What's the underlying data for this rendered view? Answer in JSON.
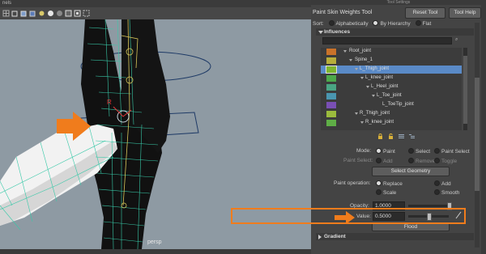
{
  "viewport": {
    "title_fragment": "nels",
    "camera_label": "persp",
    "joint_marker_label": "R",
    "toolbar_icons": [
      "grid-icon",
      "box-icon",
      "shaded-box-icon",
      "textured-icon",
      "light-icon",
      "sphere-icon",
      "isolate-icon",
      "xray-icon",
      "camera-icon",
      "frame-icon"
    ]
  },
  "panel": {
    "header": "Tool Settings",
    "tool_title": "Paint Skin Weights Tool",
    "reset_tool": "Reset Tool",
    "tool_help": "Tool Help",
    "sort": {
      "label": "Sort:",
      "options": [
        "Alphabetically",
        "By Hierarchy",
        "Flat"
      ],
      "selected": "By Hierarchy"
    },
    "influences": {
      "title": "Influences",
      "joints": [
        {
          "name": "Root_joint",
          "color": "#c9722a"
        },
        {
          "name": "Spine_1",
          "color": "#b7ad3a"
        },
        {
          "name": "L_Thigh_joint",
          "color": "#7fb62f",
          "selected": true
        },
        {
          "name": "L_knee_joint",
          "color": "#4da84a"
        },
        {
          "name": "L_Heel_joint",
          "color": "#4aa583"
        },
        {
          "name": "L_Toe_joint",
          "color": "#4a96b0"
        },
        {
          "name": "L_ToeTip_joint",
          "color": "#7a4fb4"
        },
        {
          "name": "R_Thigh_joint",
          "color": "#9bbb3d"
        },
        {
          "name": "R_knee_joint",
          "color": "#5fae46"
        }
      ]
    },
    "mode": {
      "label": "Mode:",
      "options": [
        "Paint",
        "Select",
        "Paint Select"
      ],
      "selected": "Paint"
    },
    "paint_select": {
      "label": "Paint Select:",
      "options": [
        "Add",
        "Remove",
        "Toggle"
      ]
    },
    "select_geometry": "Select Geometry",
    "paint_operation": {
      "label": "Paint operation:",
      "options": [
        "Replace",
        "Add",
        "Scale",
        "Smooth"
      ],
      "selected": "Replace"
    },
    "opacity": {
      "label": "Opacity:",
      "value": "1.0000",
      "level": 1.0
    },
    "value": {
      "label": "Value:",
      "value": "0.5000",
      "level": 0.5
    },
    "flood": "Flood",
    "gradient": "Gradient"
  },
  "colors": {
    "arrow": "#f07c1c",
    "selection": "#5a8ac7",
    "viewport_bg": "#8e9aa3"
  }
}
